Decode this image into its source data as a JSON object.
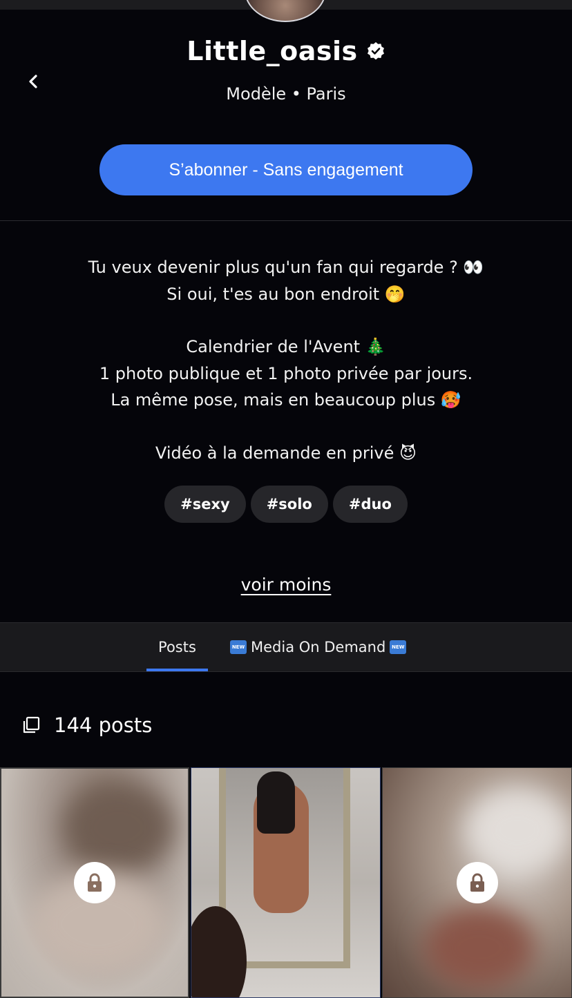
{
  "header": {
    "name": "Little_oasis",
    "subtitle": "Modèle • Paris",
    "subscribe_label": "S’abonner - Sans engagement"
  },
  "bio": {
    "lines": [
      "Tu veux devenir plus qu'un fan qui regarde ? 👀",
      "Si oui, t'es au bon endroit 🤭",
      "",
      "Calendrier de l'Avent 🎄",
      "1 photo publique et 1 photo privée par jours.",
      "La même pose, mais en beaucoup plus 🥵",
      "",
      "Vidéo à la demande en privé 😈"
    ]
  },
  "tags": [
    "#sexy",
    "#solo",
    "#duo"
  ],
  "see_less_label": "voir moins",
  "tabs": {
    "posts": "Posts",
    "media_on_demand": "Media On Demand",
    "new_badge": "NEW"
  },
  "posts_count": "144 posts",
  "colors": {
    "accent": "#3d78f0",
    "background": "#05050a",
    "tag_bg": "#26262a",
    "tab_bg": "#1a1a1d"
  },
  "icons": [
    "chevron-left-icon",
    "verified-badge-icon",
    "posts-stack-icon",
    "lock-icon"
  ]
}
